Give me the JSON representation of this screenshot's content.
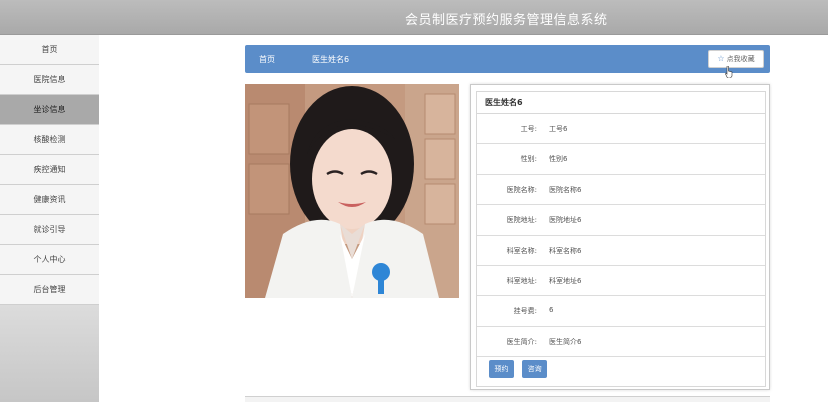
{
  "header": {
    "title": "会员制医疗预约服务管理信息系统"
  },
  "sidebar": {
    "items": [
      {
        "label": "首页"
      },
      {
        "label": "医院信息"
      },
      {
        "label": "坐诊信息"
      },
      {
        "label": "核酸检测"
      },
      {
        "label": "疾控通知"
      },
      {
        "label": "健康资讯"
      },
      {
        "label": "就诊引导"
      },
      {
        "label": "个人中心"
      },
      {
        "label": "后台管理"
      }
    ],
    "active_index": 2
  },
  "breadcrumb": {
    "home": "首页",
    "current": "医生姓名6",
    "favorite_label": "点我收藏"
  },
  "detail": {
    "title": "医生姓名6",
    "fields": [
      {
        "label": "工号:",
        "value": "工号6"
      },
      {
        "label": "性别:",
        "value": "性别6"
      },
      {
        "label": "医院名称:",
        "value": "医院名称6"
      },
      {
        "label": "医院地址:",
        "value": "医院地址6"
      },
      {
        "label": "科室名称:",
        "value": "科室名称6"
      },
      {
        "label": "科室地址:",
        "value": "科室地址6"
      },
      {
        "label": "挂号费:",
        "value": "6"
      },
      {
        "label": "医生简介:",
        "value": "医生简介6"
      }
    ],
    "buttons": {
      "book": "预约",
      "consult": "咨询"
    }
  },
  "colors": {
    "accent": "#5b8dc9",
    "header_bg": "#b3b3b3",
    "sidebar_active": "#a9a9a9"
  }
}
